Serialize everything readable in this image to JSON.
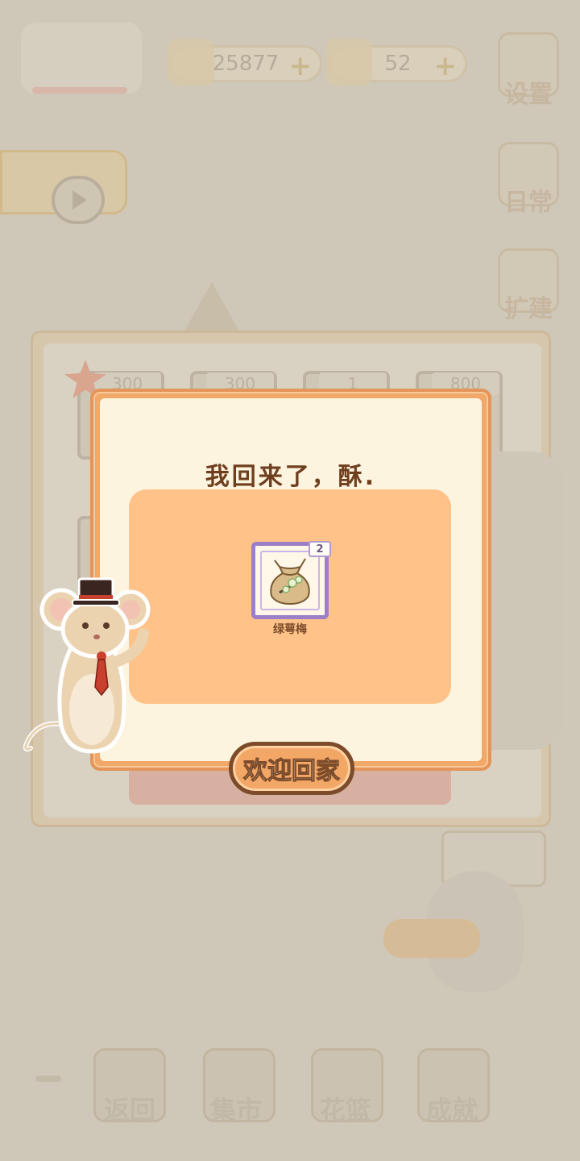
{
  "hud": {
    "fish_count": "25877",
    "cheese_count": "52",
    "add_symbol": "+",
    "settings_label": "设置",
    "daily_label": "日常",
    "expand_label": "扩建"
  },
  "bottom_nav": [
    {
      "label": "返回"
    },
    {
      "label": "集市"
    },
    {
      "label": "花篮"
    },
    {
      "label": "成就"
    }
  ],
  "background_slots": [
    "300",
    "300",
    "1",
    "800"
  ],
  "dialog": {
    "title": "我回来了，酥.",
    "item": {
      "name": "绿萼梅",
      "count": "2",
      "icon": "seed-bag-icon"
    },
    "confirm_label": "欢迎回家"
  },
  "colors": {
    "dialog_border": "#f0a969",
    "dialog_bg": "#fdf4df",
    "content_bg": "#ffc38a",
    "item_frame": "#9b7fc8",
    "text_brown": "#6e3f1e"
  }
}
